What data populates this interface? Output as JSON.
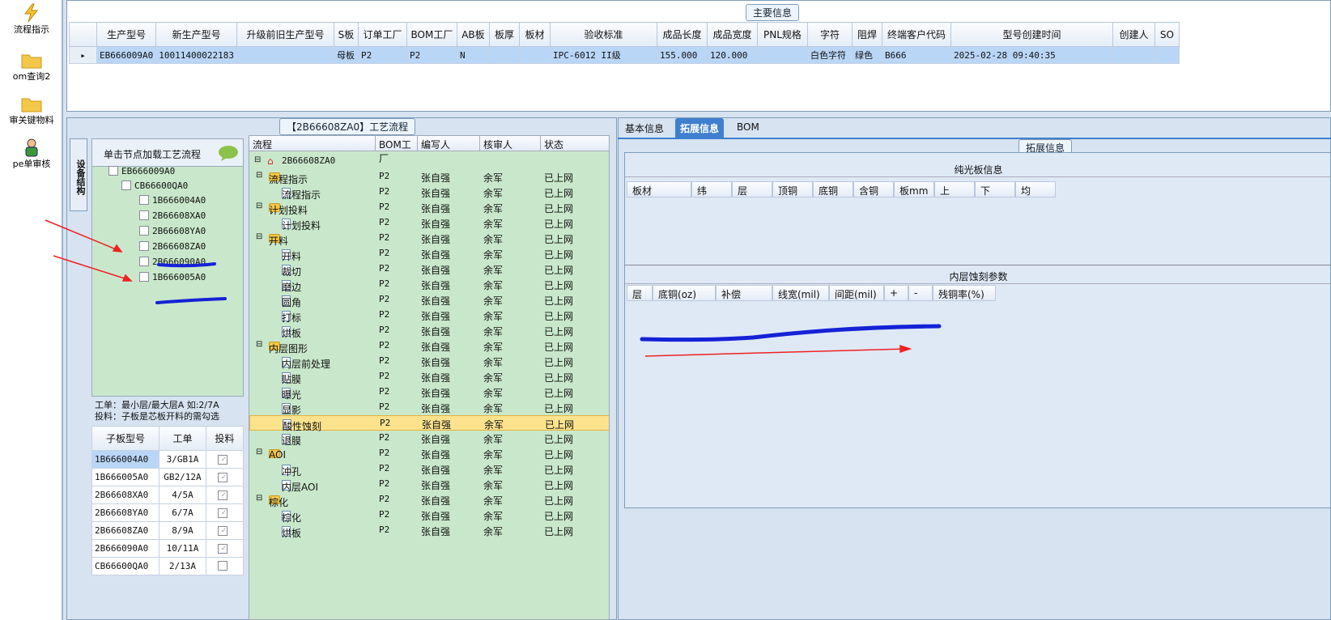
{
  "launcher": {
    "items": [
      {
        "label": "流程指示",
        "icon": "lightning-icon"
      },
      {
        "label": "om查询2",
        "icon": "folder-icon"
      },
      {
        "label": "审关键物料",
        "icon": "folder-icon"
      },
      {
        "label": "pe单审核",
        "icon": "user-icon"
      }
    ]
  },
  "main_info": {
    "caption": "主要信息",
    "columns": [
      "生产型号",
      "新生产型号",
      "升级前旧生产型号",
      "S板",
      "订单工厂",
      "BOM工厂",
      "AB板",
      "板厚",
      "板材",
      "验收标准",
      "成品长度",
      "成品宽度",
      "PNL规格",
      "字符",
      "阻焊",
      "终端客户代码",
      "型号创建时间",
      "创建人",
      "SO"
    ],
    "row": [
      "EB666009A0",
      "10011400022183",
      "",
      "母板",
      "P2",
      "P2",
      "N",
      "",
      "",
      "IPC-6012 II级",
      "155.000",
      "120.000",
      "",
      "白色字符",
      "绿色",
      "B666",
      "2025-02-28 09:40:35",
      "",
      ""
    ],
    "row_marker": "▸"
  },
  "process_panel": {
    "caption": "【2B66608ZA0】工艺流程",
    "side_tab": "设备结构",
    "tree_header": "单击节点加载工艺流程",
    "tree": {
      "root": "EB666009A0",
      "child": "CB66600QA0",
      "leaves": [
        "1B666004A0",
        "2B66608XA0",
        "2B66608YA0",
        "2B66608ZA0",
        "2B666090A0",
        "1B666005A0"
      ]
    },
    "note_line1": "工单：最小层/最大层A 如:2/7A",
    "note_line2": "投料：子板是芯板开料的需勾选",
    "sub_columns": [
      "子板型号",
      "工单",
      "投料"
    ],
    "sub_rows": [
      {
        "model": "1B666004A0",
        "order": "3/GB1A",
        "feed": true
      },
      {
        "model": "1B666005A0",
        "order": "GB2/12A",
        "feed": true
      },
      {
        "model": "2B66608XA0",
        "order": "4/5A",
        "feed": true
      },
      {
        "model": "2B66608YA0",
        "order": "6/7A",
        "feed": true
      },
      {
        "model": "2B66608ZA0",
        "order": "8/9A",
        "feed": true
      },
      {
        "model": "2B666090A0",
        "order": "10/11A",
        "feed": true
      },
      {
        "model": "CB66600QA0",
        "order": "2/13A",
        "feed": false
      }
    ],
    "proc_columns": [
      "流程",
      "BOM工厂",
      "编写人",
      "核审人",
      "状态"
    ],
    "proc_root": "2B66608ZA0",
    "proc_rows": [
      {
        "name": "流程指示",
        "level": 1,
        "folder": true
      },
      {
        "name": "流程指示",
        "level": 2,
        "folder": false
      },
      {
        "name": "计划投料",
        "level": 1,
        "folder": true
      },
      {
        "name": "计划投料",
        "level": 2,
        "folder": false
      },
      {
        "name": "开料",
        "level": 1,
        "folder": true
      },
      {
        "name": "开料",
        "level": 2,
        "folder": false
      },
      {
        "name": "裁切",
        "level": 2,
        "folder": false
      },
      {
        "name": "磨边",
        "level": 2,
        "folder": false
      },
      {
        "name": "圆角",
        "level": 2,
        "folder": false
      },
      {
        "name": "打标",
        "level": 2,
        "folder": false
      },
      {
        "name": "烘板",
        "level": 2,
        "folder": false
      },
      {
        "name": "内层图形",
        "level": 1,
        "folder": true
      },
      {
        "name": "内层前处理",
        "level": 2,
        "folder": false
      },
      {
        "name": "贴膜",
        "level": 2,
        "folder": false
      },
      {
        "name": "曝光",
        "level": 2,
        "folder": false
      },
      {
        "name": "显影",
        "level": 2,
        "folder": false
      },
      {
        "name": "酸性蚀刻",
        "level": 2,
        "folder": false,
        "selected": true
      },
      {
        "name": "退膜",
        "level": 2,
        "folder": false
      },
      {
        "name": "AOI",
        "level": 1,
        "folder": true
      },
      {
        "name": "冲孔",
        "level": 2,
        "folder": false
      },
      {
        "name": "内层AOI",
        "level": 2,
        "folder": false
      },
      {
        "name": "棕化",
        "level": 1,
        "folder": true
      },
      {
        "name": "棕化",
        "level": 2,
        "folder": false
      },
      {
        "name": "烘板",
        "level": 2,
        "folder": false
      }
    ],
    "proc_common": {
      "bom": "P2",
      "writer": "张自强",
      "reviewer": "余军",
      "status": "已上网"
    }
  },
  "right_panel": {
    "tabs": [
      "基本信息",
      "拓展信息",
      "BOM"
    ],
    "active_tab": "拓展信息",
    "caption": "拓展信息",
    "section1_title": "纯光板信息",
    "section1_cols": [
      "板材",
      "纬",
      "层",
      "顶铜",
      "底铜",
      "含铜",
      "板mm",
      "上",
      "下",
      "均"
    ],
    "section2_title": "内层蚀刻参数",
    "section2_cols": [
      "层",
      "底铜(oz)",
      "补偿",
      "线宽(mil)",
      "间距(mil)",
      "+",
      "-",
      "残铜率(%)"
    ]
  },
  "colors": {
    "header_blue": "#3f7fd0",
    "tree_green": "#c9e8cb",
    "selected_row": "#bad6f7",
    "selected_yellow": "#fbe38e"
  }
}
